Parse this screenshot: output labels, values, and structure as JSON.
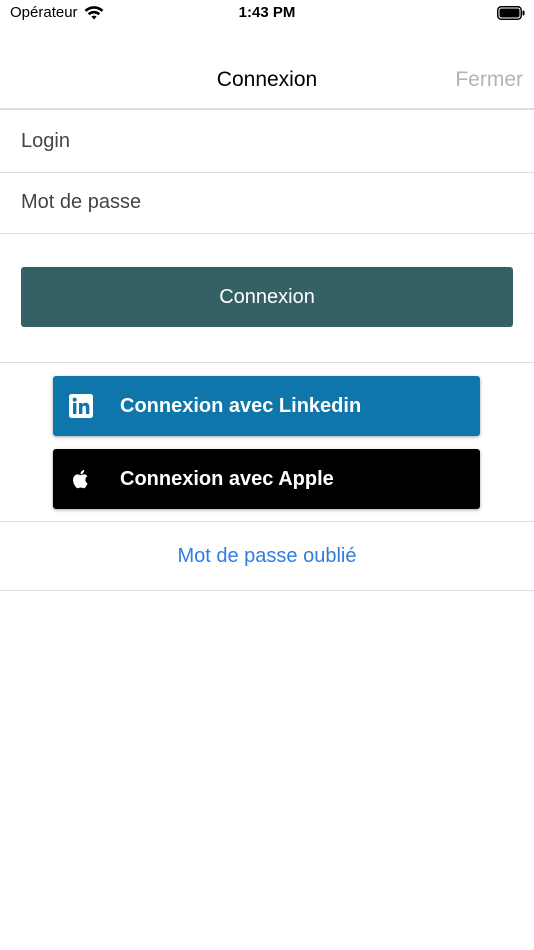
{
  "status_bar": {
    "carrier": "Opérateur",
    "time": "1:43 PM"
  },
  "nav": {
    "title": "Connexion",
    "close_label": "Fermer"
  },
  "form": {
    "login_placeholder": "Login",
    "password_placeholder": "Mot de passe",
    "login_value": "",
    "password_value": "",
    "submit_label": "Connexion"
  },
  "social": {
    "linkedin_label": "Connexion avec Linkedin",
    "linkedin_icon": "linkedin-icon",
    "apple_label": "Connexion avec Apple",
    "apple_icon": "apple-icon"
  },
  "forgot_password_label": "Mot de passe oublié",
  "colors": {
    "primary_button": "#336166",
    "linkedin": "#0e76ab",
    "apple": "#000000",
    "link": "#2f7de1",
    "close_disabled": "#b4b4b4"
  }
}
